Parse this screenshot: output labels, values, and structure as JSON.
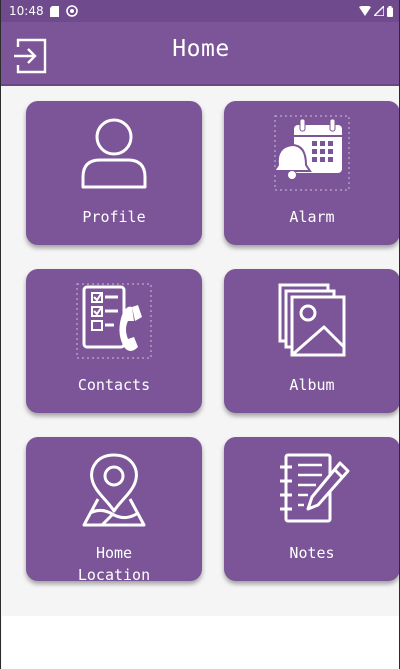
{
  "status_bar": {
    "time": "10:48"
  },
  "app_bar": {
    "title": "Home"
  },
  "tiles": [
    {
      "label": "Profile",
      "icon": "person-icon"
    },
    {
      "label": "Alarm",
      "icon": "calendar-alarm-icon"
    },
    {
      "label": "Contacts",
      "icon": "contact-list-phone-icon"
    },
    {
      "label": "Album",
      "icon": "photo-album-icon"
    },
    {
      "label": "Home\nLocation",
      "icon": "map-pin-icon"
    },
    {
      "label": "Notes",
      "icon": "notebook-pen-icon"
    }
  ],
  "colors": {
    "status_bar": "#6f4a8c",
    "app_bar": "#7b5597",
    "tile": "#7b5597",
    "text": "#ffffff"
  }
}
